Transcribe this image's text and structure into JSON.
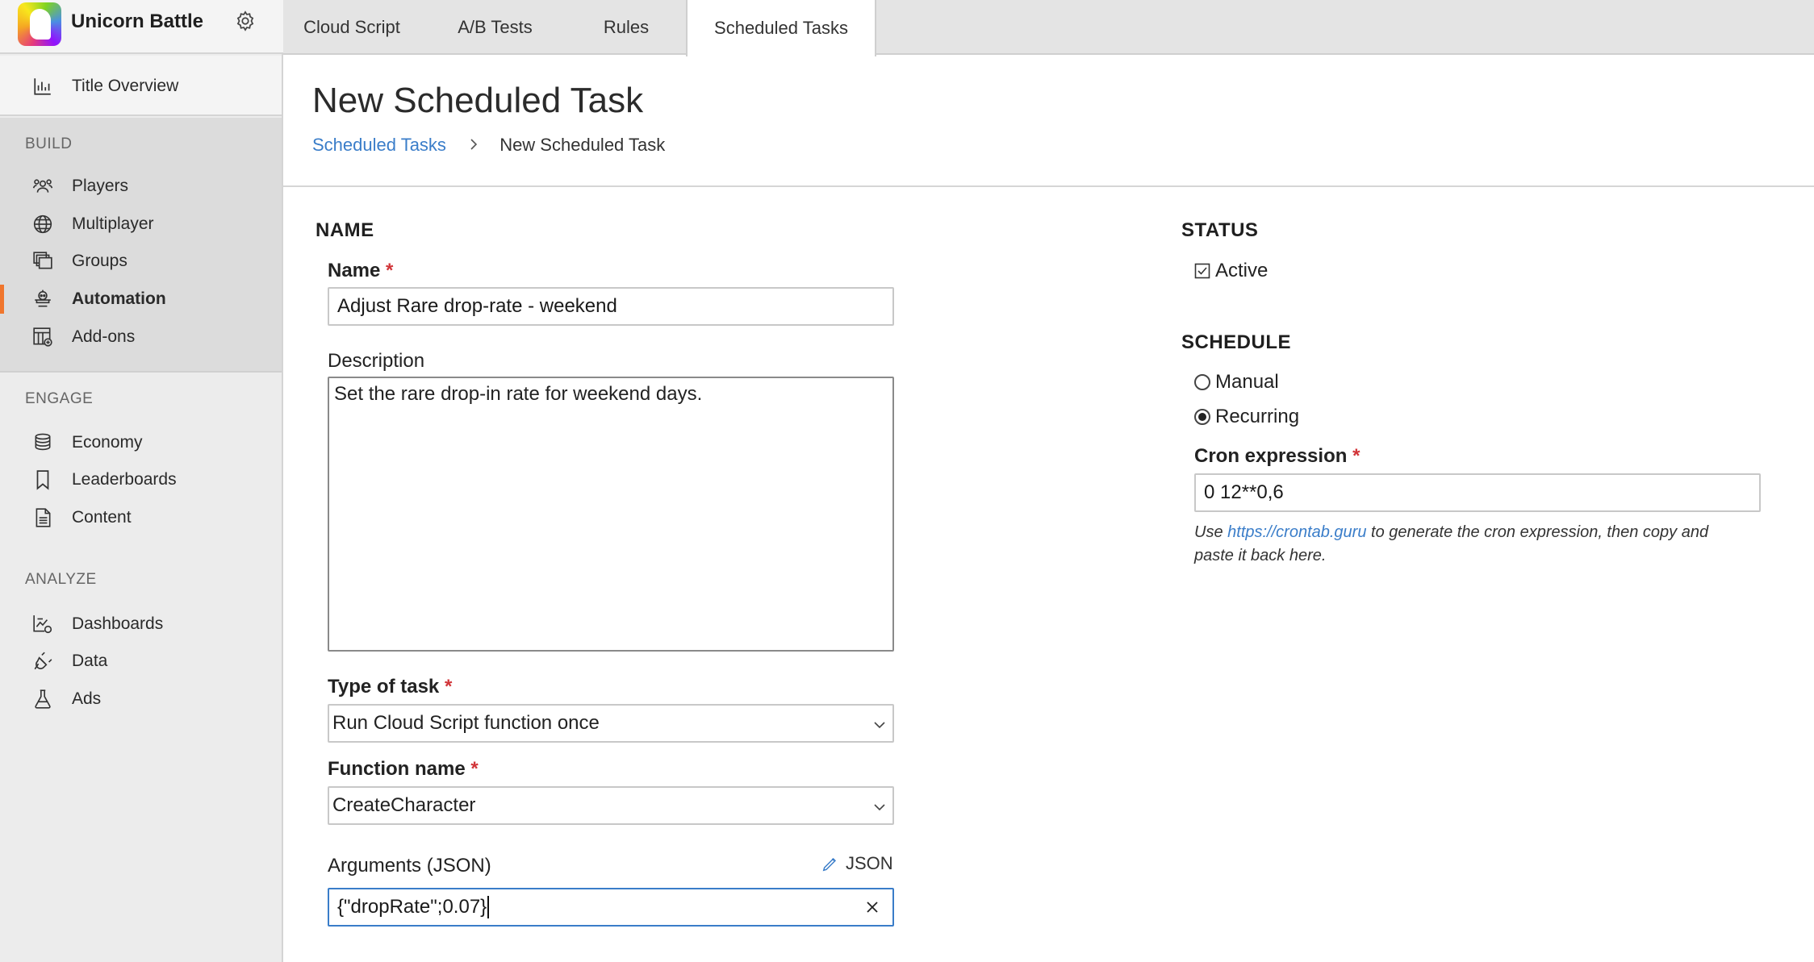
{
  "app": {
    "title": "Unicorn Battle"
  },
  "sidebar": {
    "title_overview": "Title Overview",
    "sections": [
      {
        "label": "BUILD",
        "items": [
          "Players",
          "Multiplayer",
          "Groups",
          "Automation",
          "Add-ons"
        ]
      },
      {
        "label": "ENGAGE",
        "items": [
          "Economy",
          "Leaderboards",
          "Content"
        ]
      },
      {
        "label": "ANALYZE",
        "items": [
          "Dashboards",
          "Data",
          "Ads"
        ]
      }
    ],
    "active_item": "Automation"
  },
  "tabs": [
    "Cloud Script",
    "A/B Tests",
    "Rules",
    "Scheduled Tasks"
  ],
  "active_tab": "Scheduled Tasks",
  "page": {
    "title": "New Scheduled Task",
    "breadcrumb": {
      "link": "Scheduled Tasks",
      "current": "New Scheduled Task"
    }
  },
  "form": {
    "name_section": "NAME",
    "name_label": "Name",
    "name_value": "Adjust Rare drop-rate - weekend",
    "description_label": "Description",
    "description_value": "Set the rare drop-in rate for weekend days.",
    "task_type_label": "Type of task",
    "task_type_value": "Run Cloud Script function once",
    "function_label": "Function name",
    "function_value": "CreateCharacter",
    "args_label": "Arguments (JSON)",
    "json_link": "JSON",
    "args_value": "{\"dropRate\";0.07}",
    "required_mark": "*"
  },
  "status": {
    "section": "STATUS",
    "active_label": "Active",
    "active_checked": true
  },
  "schedule": {
    "section": "SCHEDULE",
    "manual_label": "Manual",
    "recurring_label": "Recurring",
    "selected": "Recurring",
    "cron_label": "Cron expression",
    "cron_value": "0 12**0,6",
    "hint_prefix": "Use",
    "hint_link": "https://crontab.guru",
    "hint_suffix": "to generate the cron expression, then copy and paste it back here."
  },
  "colors": {
    "accent": "#f0762d",
    "link": "#3a7dc9",
    "required": "#d13438"
  }
}
